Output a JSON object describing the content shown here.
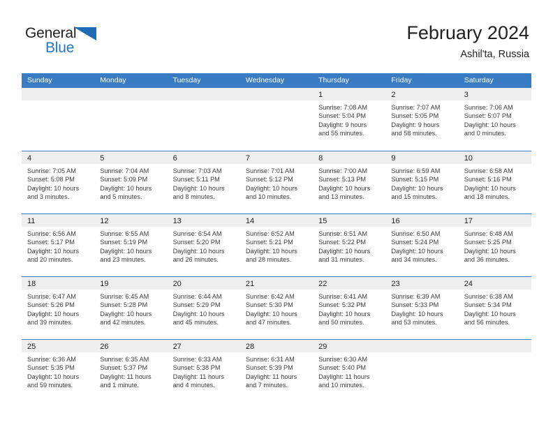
{
  "brand": {
    "name_top": "General",
    "name_bottom": "Blue",
    "triangle_color": "#1f6cb5",
    "blue_color": "#2079c8"
  },
  "header": {
    "title": "February 2024",
    "location": "Ashil'ta, Russia"
  },
  "theme": {
    "header_blue": "#3a7cc4",
    "day_head_gray": "#eeeeee",
    "text": "#231f20"
  },
  "weekdays": [
    "Sunday",
    "Monday",
    "Tuesday",
    "Wednesday",
    "Thursday",
    "Friday",
    "Saturday"
  ],
  "weeks": [
    [
      {
        "day": "",
        "lines": []
      },
      {
        "day": "",
        "lines": []
      },
      {
        "day": "",
        "lines": []
      },
      {
        "day": "",
        "lines": []
      },
      {
        "day": "1",
        "lines": [
          "Sunrise: 7:08 AM",
          "Sunset: 5:04 PM",
          "Daylight: 9 hours",
          "and 55 minutes."
        ]
      },
      {
        "day": "2",
        "lines": [
          "Sunrise: 7:07 AM",
          "Sunset: 5:05 PM",
          "Daylight: 9 hours",
          "and 58 minutes."
        ]
      },
      {
        "day": "3",
        "lines": [
          "Sunrise: 7:06 AM",
          "Sunset: 5:07 PM",
          "Daylight: 10 hours",
          "and 0 minutes."
        ]
      }
    ],
    [
      {
        "day": "4",
        "lines": [
          "Sunrise: 7:05 AM",
          "Sunset: 5:08 PM",
          "Daylight: 10 hours",
          "and 3 minutes."
        ]
      },
      {
        "day": "5",
        "lines": [
          "Sunrise: 7:04 AM",
          "Sunset: 5:09 PM",
          "Daylight: 10 hours",
          "and 5 minutes."
        ]
      },
      {
        "day": "6",
        "lines": [
          "Sunrise: 7:03 AM",
          "Sunset: 5:11 PM",
          "Daylight: 10 hours",
          "and 8 minutes."
        ]
      },
      {
        "day": "7",
        "lines": [
          "Sunrise: 7:01 AM",
          "Sunset: 5:12 PM",
          "Daylight: 10 hours",
          "and 10 minutes."
        ]
      },
      {
        "day": "8",
        "lines": [
          "Sunrise: 7:00 AM",
          "Sunset: 5:13 PM",
          "Daylight: 10 hours",
          "and 13 minutes."
        ]
      },
      {
        "day": "9",
        "lines": [
          "Sunrise: 6:59 AM",
          "Sunset: 5:15 PM",
          "Daylight: 10 hours",
          "and 15 minutes."
        ]
      },
      {
        "day": "10",
        "lines": [
          "Sunrise: 6:58 AM",
          "Sunset: 5:16 PM",
          "Daylight: 10 hours",
          "and 18 minutes."
        ]
      }
    ],
    [
      {
        "day": "11",
        "lines": [
          "Sunrise: 6:56 AM",
          "Sunset: 5:17 PM",
          "Daylight: 10 hours",
          "and 20 minutes."
        ]
      },
      {
        "day": "12",
        "lines": [
          "Sunrise: 6:55 AM",
          "Sunset: 5:19 PM",
          "Daylight: 10 hours",
          "and 23 minutes."
        ]
      },
      {
        "day": "13",
        "lines": [
          "Sunrise: 6:54 AM",
          "Sunset: 5:20 PM",
          "Daylight: 10 hours",
          "and 26 minutes."
        ]
      },
      {
        "day": "14",
        "lines": [
          "Sunrise: 6:52 AM",
          "Sunset: 5:21 PM",
          "Daylight: 10 hours",
          "and 28 minutes."
        ]
      },
      {
        "day": "15",
        "lines": [
          "Sunrise: 6:51 AM",
          "Sunset: 5:22 PM",
          "Daylight: 10 hours",
          "and 31 minutes."
        ]
      },
      {
        "day": "16",
        "lines": [
          "Sunrise: 6:50 AM",
          "Sunset: 5:24 PM",
          "Daylight: 10 hours",
          "and 34 minutes."
        ]
      },
      {
        "day": "17",
        "lines": [
          "Sunrise: 6:48 AM",
          "Sunset: 5:25 PM",
          "Daylight: 10 hours",
          "and 36 minutes."
        ]
      }
    ],
    [
      {
        "day": "18",
        "lines": [
          "Sunrise: 6:47 AM",
          "Sunset: 5:26 PM",
          "Daylight: 10 hours",
          "and 39 minutes."
        ]
      },
      {
        "day": "19",
        "lines": [
          "Sunrise: 6:45 AM",
          "Sunset: 5:28 PM",
          "Daylight: 10 hours",
          "and 42 minutes."
        ]
      },
      {
        "day": "20",
        "lines": [
          "Sunrise: 6:44 AM",
          "Sunset: 5:29 PM",
          "Daylight: 10 hours",
          "and 45 minutes."
        ]
      },
      {
        "day": "21",
        "lines": [
          "Sunrise: 6:42 AM",
          "Sunset: 5:30 PM",
          "Daylight: 10 hours",
          "and 47 minutes."
        ]
      },
      {
        "day": "22",
        "lines": [
          "Sunrise: 6:41 AM",
          "Sunset: 5:32 PM",
          "Daylight: 10 hours",
          "and 50 minutes."
        ]
      },
      {
        "day": "23",
        "lines": [
          "Sunrise: 6:39 AM",
          "Sunset: 5:33 PM",
          "Daylight: 10 hours",
          "and 53 minutes."
        ]
      },
      {
        "day": "24",
        "lines": [
          "Sunrise: 6:38 AM",
          "Sunset: 5:34 PM",
          "Daylight: 10 hours",
          "and 56 minutes."
        ]
      }
    ],
    [
      {
        "day": "25",
        "lines": [
          "Sunrise: 6:36 AM",
          "Sunset: 5:35 PM",
          "Daylight: 10 hours",
          "and 59 minutes."
        ]
      },
      {
        "day": "26",
        "lines": [
          "Sunrise: 6:35 AM",
          "Sunset: 5:37 PM",
          "Daylight: 11 hours",
          "and 1 minute."
        ]
      },
      {
        "day": "27",
        "lines": [
          "Sunrise: 6:33 AM",
          "Sunset: 5:38 PM",
          "Daylight: 11 hours",
          "and 4 minutes."
        ]
      },
      {
        "day": "28",
        "lines": [
          "Sunrise: 6:31 AM",
          "Sunset: 5:39 PM",
          "Daylight: 11 hours",
          "and 7 minutes."
        ]
      },
      {
        "day": "29",
        "lines": [
          "Sunrise: 6:30 AM",
          "Sunset: 5:40 PM",
          "Daylight: 11 hours",
          "and 10 minutes."
        ]
      },
      {
        "day": "",
        "lines": []
      },
      {
        "day": "",
        "lines": []
      }
    ]
  ]
}
